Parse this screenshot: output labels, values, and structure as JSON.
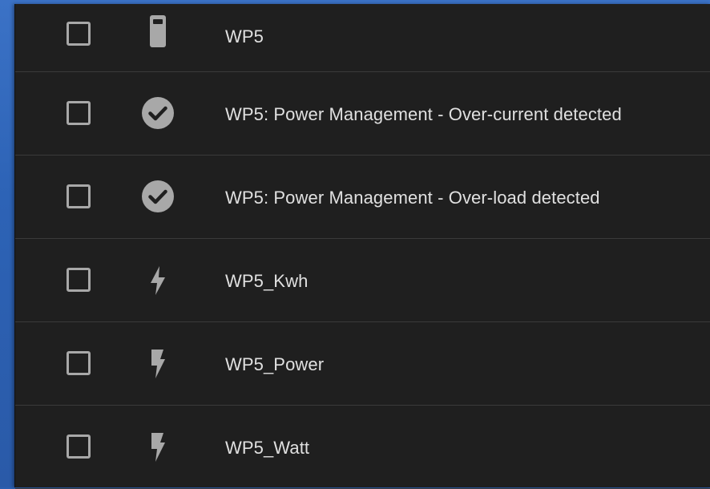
{
  "entities": [
    {
      "label": "WP5",
      "icon": "device-icon",
      "checked": false
    },
    {
      "label": "WP5: Power Management - Over-current detected",
      "icon": "check-circle-icon",
      "checked": false
    },
    {
      "label": "WP5: Power Management - Over-load detected",
      "icon": "check-circle-icon",
      "checked": false
    },
    {
      "label": "WP5_Kwh",
      "icon": "lightning-icon",
      "checked": false
    },
    {
      "label": "WP5_Power",
      "icon": "flash-icon",
      "checked": false
    },
    {
      "label": "WP5_Watt",
      "icon": "flash-icon",
      "checked": false
    }
  ],
  "colors": {
    "panel_background": "#1f1f1f",
    "row_divider": "#3a3a3a",
    "icon": "#a8a8a8",
    "text": "#e0e0e0",
    "desktop_background": "#2d63b6"
  }
}
